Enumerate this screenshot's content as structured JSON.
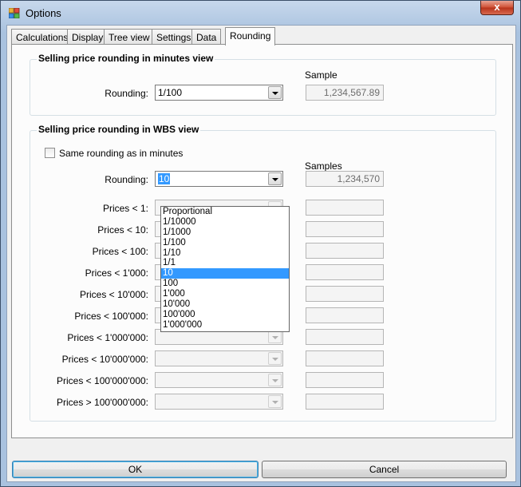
{
  "window": {
    "title": "Options",
    "close_symbol": "x"
  },
  "tabs": [
    {
      "label": "Calculations"
    },
    {
      "label": "Display"
    },
    {
      "label": "Tree view"
    },
    {
      "label": "Settings"
    },
    {
      "label": "Data"
    },
    {
      "label": "Rounding",
      "active": true
    }
  ],
  "minutes_group": {
    "title": "Selling price rounding in minutes view",
    "rounding_label": "Rounding:",
    "rounding_value": "1/100",
    "sample_header": "Sample",
    "sample_value": "1,234,567.89"
  },
  "wbs_group": {
    "title": "Selling price rounding in WBS view",
    "same_rounding_label": "Same rounding as in minutes",
    "same_rounding_checked": false,
    "rounding_label": "Rounding:",
    "rounding_value": "10",
    "samples_header": "Samples",
    "samples_value": "1,234,570",
    "price_rows": [
      {
        "label": "Prices < 1:"
      },
      {
        "label": "Prices < 10:"
      },
      {
        "label": "Prices < 100:"
      },
      {
        "label": "Prices < 1'000:"
      },
      {
        "label": "Prices < 10'000:"
      },
      {
        "label": "Prices < 100'000:"
      },
      {
        "label": "Prices < 1'000'000:"
      },
      {
        "label": "Prices < 10'000'000:"
      },
      {
        "label": "Prices < 100'000'000:"
      },
      {
        "label": "Prices > 100'000'000:"
      }
    ]
  },
  "dropdown": {
    "options": [
      "Proportional",
      "1/10000",
      "1/1000",
      "1/100",
      "1/10",
      "1/1",
      "10",
      "100",
      "1'000",
      "10'000",
      "100'000",
      "1'000'000"
    ],
    "selected": "10"
  },
  "buttons": {
    "ok": "OK",
    "cancel": "Cancel"
  },
  "colors": {
    "selection": "#3399ff",
    "title_bar": "#a9c2df",
    "close_button": "#c74a33"
  }
}
